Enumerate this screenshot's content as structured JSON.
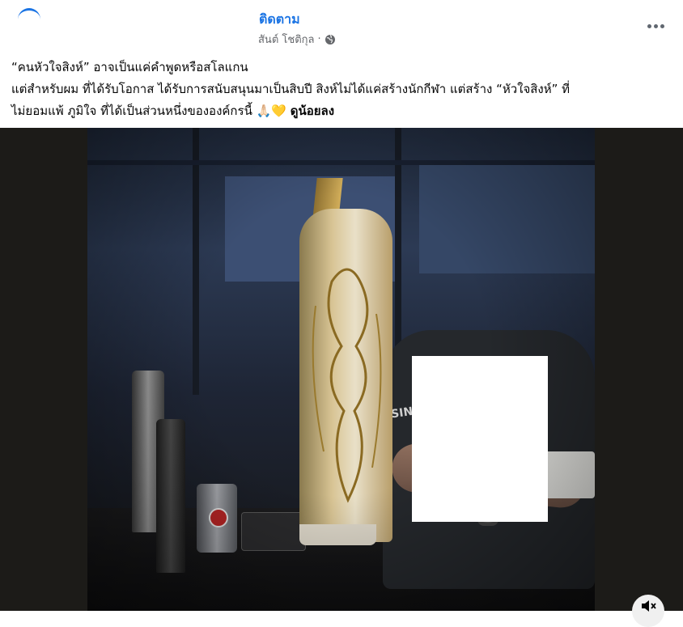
{
  "header": {
    "follow_label": "ติดตาม",
    "author_name": "สันต์ โชติกุล",
    "separator": "·",
    "privacy_icon": "globe-icon",
    "more_icon": "more-options-icon"
  },
  "post": {
    "lines": [
      "“คนหัวใจสิงห์” อาจเป็นแค่คำพูดหรือสโลแกน",
      "แต่สำหรับผม ที่ได้รับโอกาส ได้รับการสนับสนุนมาเป็นสิบปี สิงห์ไม่ได้แค่สร้างนักกีฬา แต่สร้าง “หัวใจสิงห์” ที่",
      "ไม่ยอมแพ้ ภูมิใจ ที่ได้เป็นส่วนหนึ่งขององค์กรนี้ 🙏🏻💛"
    ],
    "see_more_label": "ดูน้อยลง"
  },
  "media": {
    "shirt_text": "SINGHA",
    "audio_icon": "speaker-muted-icon"
  },
  "colors": {
    "link": "#1b74e4",
    "meta": "#65676b",
    "text": "#050505"
  }
}
